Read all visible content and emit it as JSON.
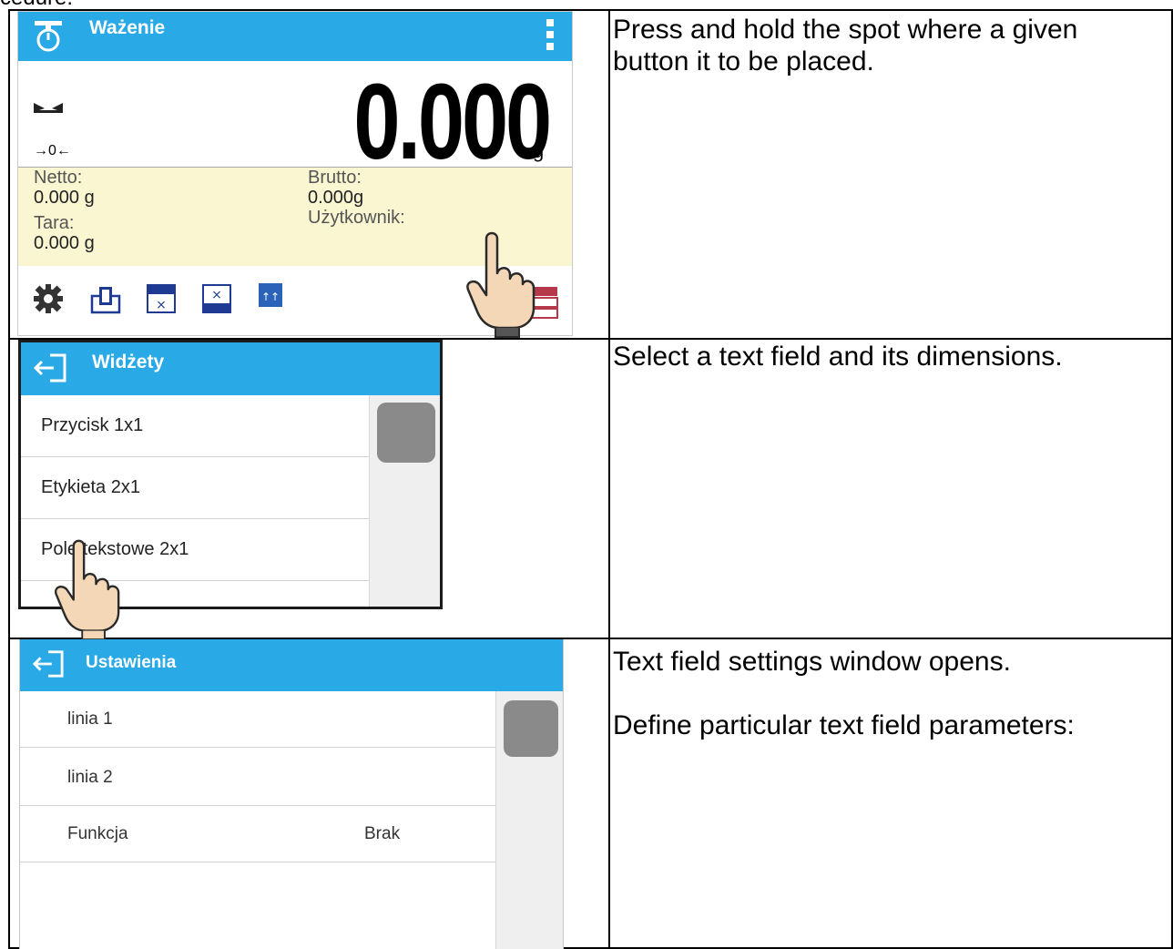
{
  "top_snippet": "cedure:",
  "rows": [
    {
      "instruction_lines": [
        "Press and hold the spot where a given",
        "button it to be placed."
      ]
    },
    {
      "instruction_lines": [
        "Select a text field and its dimensions."
      ]
    },
    {
      "instruction_lines": [
        "Text field settings window opens."
      ],
      "instruction_lines_2": [
        "Define particular text field parameters:"
      ]
    }
  ],
  "screen_weighing": {
    "title": "Ważenie",
    "weight": "0.000",
    "unit": "g",
    "zero_indicator": "→0←",
    "fields": {
      "netto_label": "Netto:",
      "netto_value": "0.000 g",
      "brutto_label": "Brutto:",
      "brutto_value": "0.000g",
      "tara_label": "Tara:",
      "tara_value": "0.000 g",
      "user_label": "Użytkownik:"
    },
    "header_color": "#29a9e6",
    "info_bg_color": "#fbf6d2"
  },
  "screen_widgets": {
    "title": "Widżety",
    "items": [
      {
        "label": "Przycisk 1x1"
      },
      {
        "label": "Etykieta 2x1"
      },
      {
        "label": "Pole tekstowe 2x1"
      }
    ]
  },
  "screen_settings": {
    "title": "Ustawienia",
    "items": [
      {
        "label": "linia 1",
        "value": ""
      },
      {
        "label": "linia 2",
        "value": ""
      },
      {
        "label": "Funkcja",
        "value": "Brak"
      }
    ]
  }
}
